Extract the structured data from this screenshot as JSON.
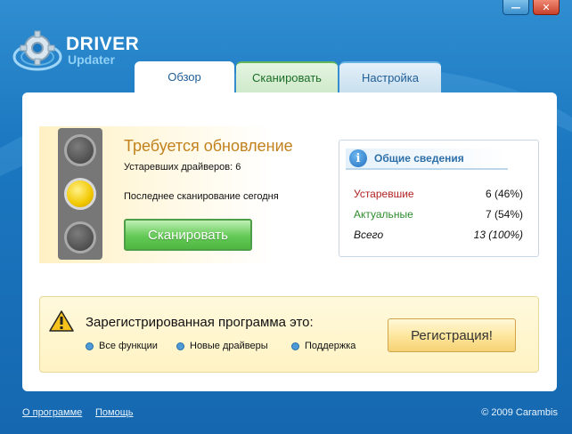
{
  "window": {
    "minimize_label": "—",
    "close_label": "✕"
  },
  "logo": {
    "main": "DRIVER",
    "sub": "Updater"
  },
  "tabs": [
    {
      "label": "Обзор"
    },
    {
      "label": "Сканировать"
    },
    {
      "label": "Настройка"
    }
  ],
  "status": {
    "title": "Требуется обновление",
    "outdated_line": "Устаревших драйверов: 6",
    "last_scan_line": "Последнее сканирование  сегодня",
    "scan_button": "Сканировать"
  },
  "info": {
    "title": "Общие сведения",
    "icon_glyph": "i",
    "rows": [
      {
        "label": "Устаревшие",
        "value": "6 (46%)"
      },
      {
        "label": "Актуальные",
        "value": "7 (54%)"
      },
      {
        "label": "Всего",
        "value": "13 (100%)"
      }
    ]
  },
  "registration": {
    "title": "Зарегистрированная программа это:",
    "features": [
      "Все функции",
      "Новые драйверы",
      "Поддержка"
    ],
    "button": "Регистрация!"
  },
  "footer": {
    "about": "О программе",
    "help": "Помощь",
    "copyright": "© 2009 Carambis"
  },
  "colors": {
    "background": "#1b77c0",
    "status_title": "#c2811d",
    "outdated": "#b22222",
    "current": "#2e8b2e",
    "scan_button": "#63c955",
    "reg_button": "#fde59a"
  },
  "icons": {
    "logo": "gear-disc-icon",
    "info": "info-icon",
    "warning": "warning-icon",
    "traffic_light": "traffic-light-icon"
  },
  "traffic_light_state": "yellow"
}
